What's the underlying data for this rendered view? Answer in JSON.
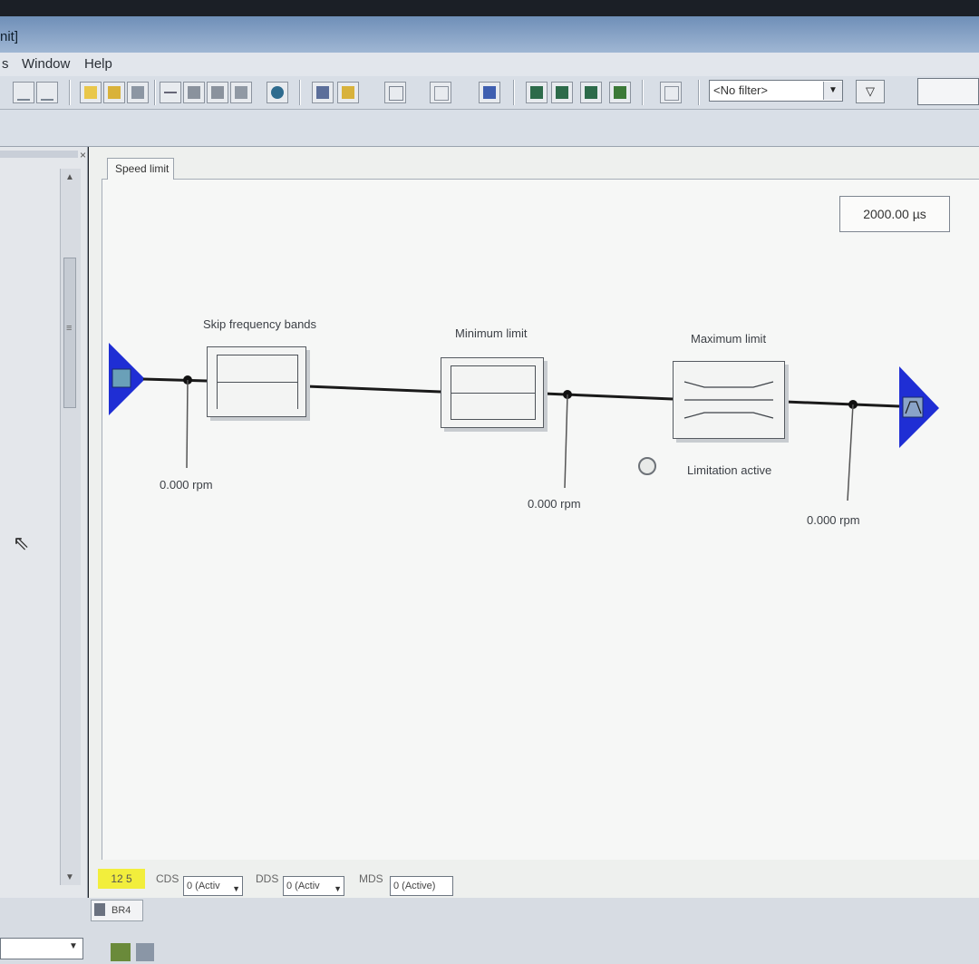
{
  "window": {
    "title_fragment": "nit]"
  },
  "menu": {
    "items": [
      "s",
      "Window",
      "Help"
    ]
  },
  "toolbar": {
    "filter_value": "<No filter>",
    "icons": [
      "x1-icon",
      "x2-icon",
      "folder-icon",
      "open-icon",
      "save-icon",
      "connect-icon",
      "upload-icon",
      "download-icon",
      "compare-icon",
      "expert-icon",
      "reset-icon",
      "device-icon",
      "list-icon",
      "table-icon",
      "drive-icon",
      "trace-icon",
      "measure-icon",
      "oscilloscope-icon",
      "chart-icon",
      "config-icon",
      "filter-edit-icon"
    ]
  },
  "diagram": {
    "tab_label": "Speed limit",
    "sample_time": "2000.00 µs",
    "blocks": {
      "skip": {
        "label": "Skip frequency bands"
      },
      "min": {
        "label": "Minimum limit"
      },
      "max": {
        "label": "Maximum limit"
      }
    },
    "values": {
      "input": "0.000 rpm",
      "after_min": "0.000 rpm",
      "output": "0.000 rpm"
    },
    "status_text": "Limitation active"
  },
  "status": {
    "revision": "12  5",
    "cds_label": "CDS",
    "cds_value": "0 (Activ",
    "dds_label": "DDS",
    "dds_value": "0 (Activ",
    "mds_label": "MDS",
    "mds_value": "0 (Active)"
  },
  "bottom": {
    "tab_label": "BR4"
  }
}
